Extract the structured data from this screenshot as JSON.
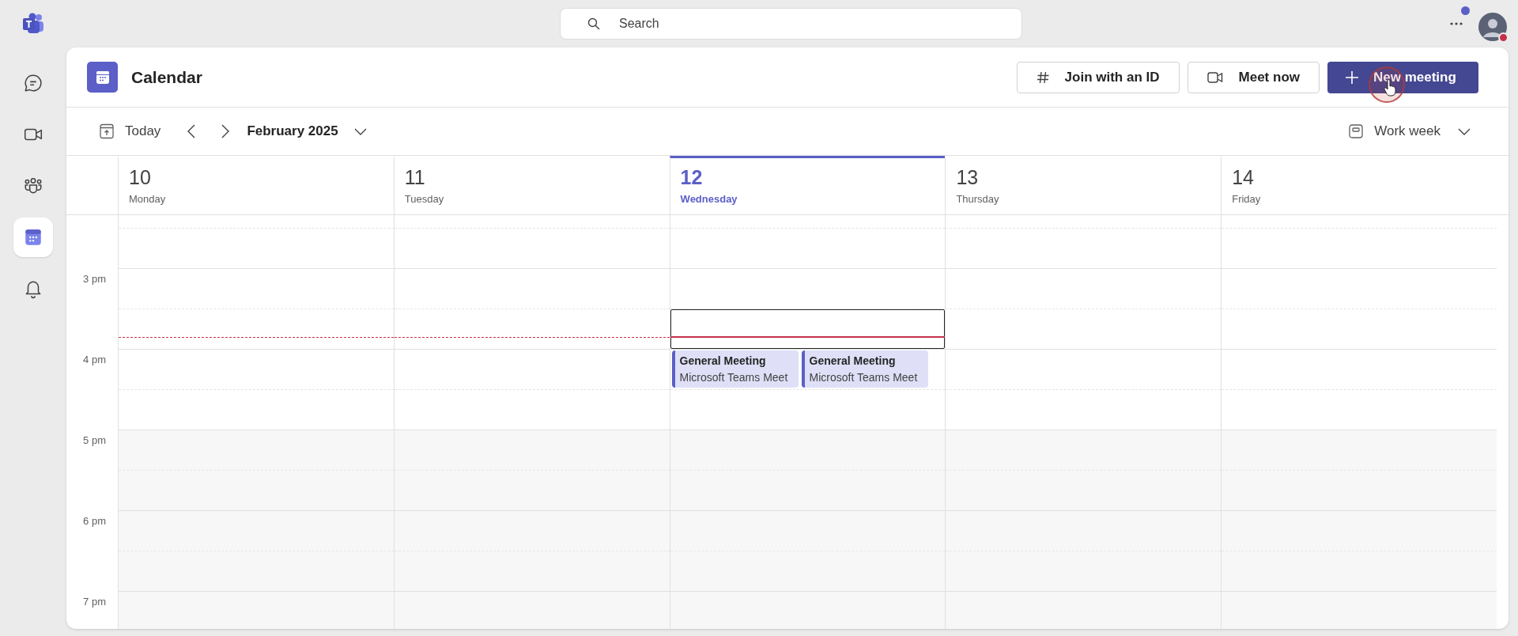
{
  "top_bar": {
    "search": {
      "placeholder": "Search"
    }
  },
  "rail": {
    "items": [
      {
        "kind": "chat",
        "selected": false
      },
      {
        "kind": "video",
        "selected": false
      },
      {
        "kind": "people",
        "selected": false
      },
      {
        "kind": "calendar",
        "selected": true
      },
      {
        "kind": "bell",
        "selected": false
      }
    ]
  },
  "header": {
    "title": "Calendar",
    "buttons": [
      {
        "kind": "join",
        "label": "Join with an ID"
      },
      {
        "kind": "meet",
        "label": "Meet now"
      },
      {
        "kind": "new",
        "label": "New meeting"
      }
    ]
  },
  "toolbar": {
    "today": "Today",
    "month": "February 2025",
    "view": "Work week"
  },
  "days": [
    {
      "date": "10",
      "weekday": "Monday",
      "selected": false
    },
    {
      "date": "11",
      "weekday": "Tuesday",
      "selected": false
    },
    {
      "date": "12",
      "weekday": "Wednesday",
      "selected": true,
      "events": [
        {
          "title": "General Meeting",
          "subtitle": "Microsoft Teams Meet"
        },
        {
          "title": "General Meeting",
          "subtitle": "Microsoft Teams Meet"
        }
      ]
    },
    {
      "date": "13",
      "weekday": "Thursday",
      "selected": false
    },
    {
      "date": "14",
      "weekday": "Friday",
      "selected": false
    }
  ],
  "time_labels": [
    "3 pm",
    "4 pm",
    "5 pm",
    "6 pm",
    "7 pm"
  ]
}
